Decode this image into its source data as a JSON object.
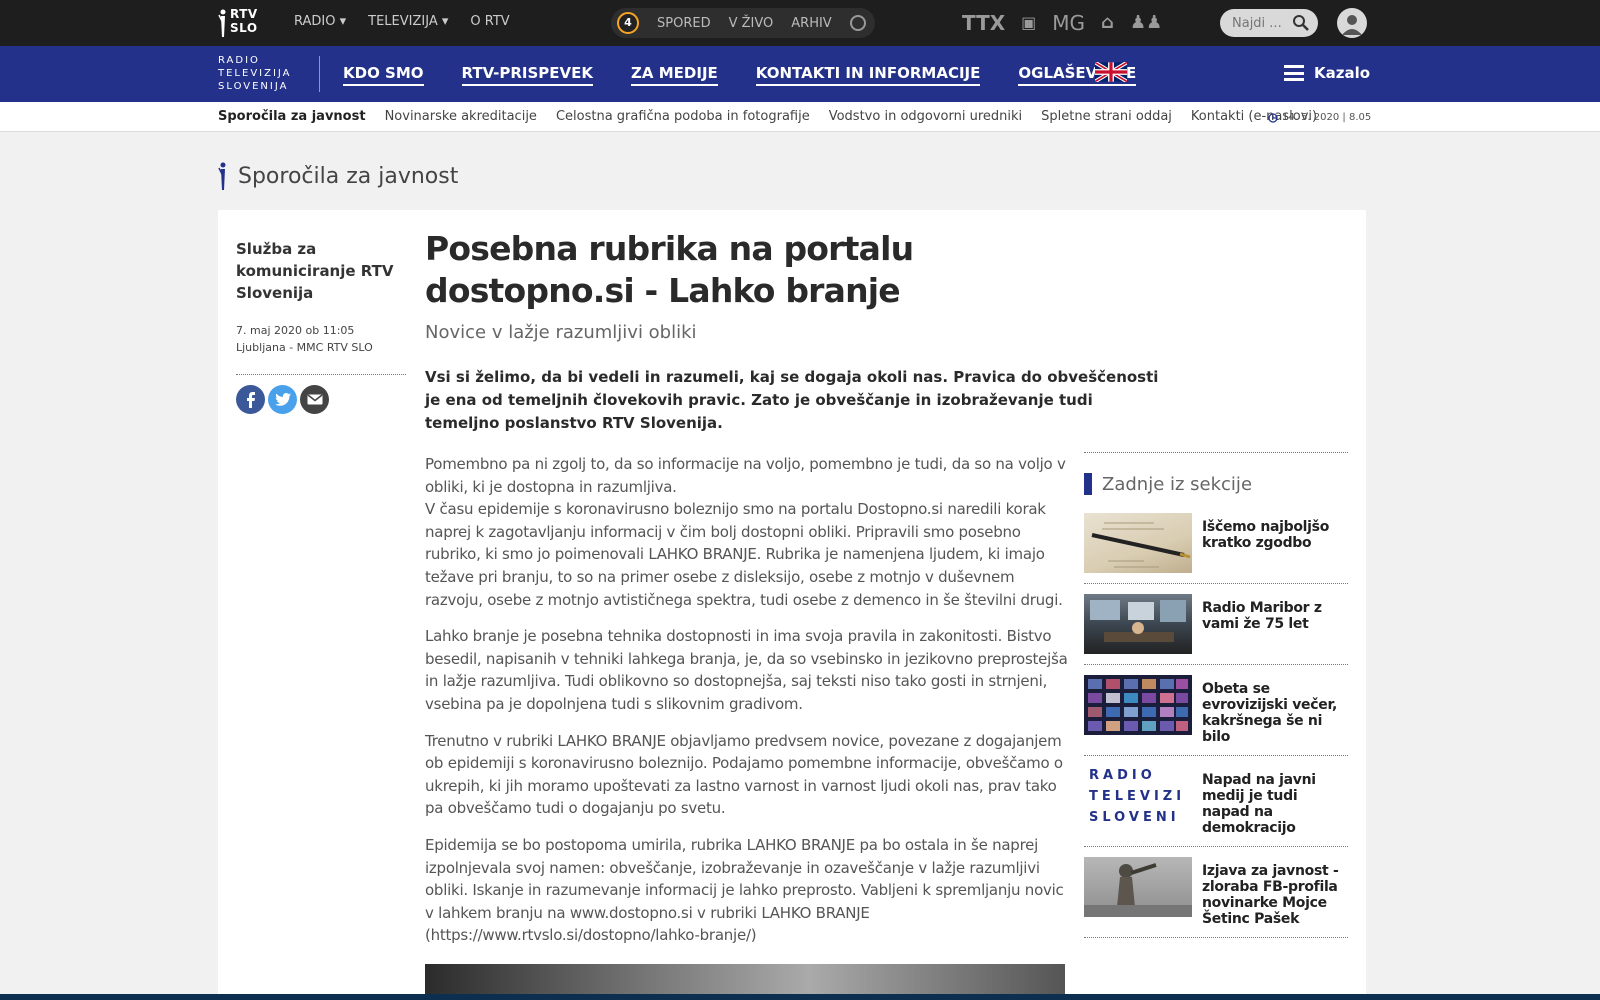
{
  "topbar": {
    "logo_text": [
      "RTV",
      "SLO"
    ],
    "nav": [
      "RADIO",
      "TELEVIZIJA",
      "O RTV"
    ],
    "pill_channel": "4",
    "pill_items": [
      "SPORED",
      "V ŽIVO",
      "ARHIV"
    ],
    "brand_icons": [
      "TTX",
      "Otv",
      "MG",
      "rtv",
      "ljudje"
    ],
    "search_placeholder": "Najdi ...",
    "colors": {
      "bg": "#1e1e1e",
      "channel_ring": "#f4a623"
    }
  },
  "bluebar": {
    "org_lines": [
      "RADIO",
      "TELEVIZIJA",
      "SLOVENIJA"
    ],
    "nav": [
      "KDO SMO",
      "RTV-PRISPEVEK",
      "ZA MEDIJE",
      "KONTAKTI IN INFORMACIJE",
      "OGLAŠEVANJE"
    ],
    "kazalo": "Kazalo",
    "color": "#23318a"
  },
  "subnav": {
    "items": [
      "Sporočila za javnost",
      "Novinarske akreditacije",
      "Celostna grafična podoba in fotografije",
      "Vodstvo in odgovorni uredniki",
      "Spletne strani oddaj",
      "Kontakti (e-naslovi)"
    ],
    "active_index": 0,
    "date": "14. 5. 2020 | 8.05"
  },
  "section": {
    "title": "Sporočila za javnost"
  },
  "article": {
    "author": "Služba za komuniciranje RTV Slovenija",
    "date": "7. maj 2020 ob 11:05",
    "place": "Ljubljana - MMC RTV SLO",
    "share": [
      "facebook",
      "twitter",
      "email"
    ],
    "headline": "Posebna rubrika na portalu dostopno.si - Lahko branje",
    "subtitle": "Novice v lažje razumljivi obliki",
    "lead": "Vsi si želimo, da bi vedeli in razumeli, kaj se dogaja okoli nas. Pravica do obveščenosti je ena od temeljnih človekovih pravic. Zato je obveščanje in izobraževanje tudi temeljno poslanstvo RTV Slovenija.",
    "p1a": "Pomembno pa ni zgolj to, da so informacije na voljo, pomembno je tudi, da so na voljo v obliki, ki je dostopna in razumljiva.",
    "p1b": "V času epidemije s koronavirusno boleznijo smo na portalu Dostopno.si naredili korak naprej k zagotavljanju informacij v čim bolj dostopni obliki. Pripravili smo posebno rubriko, ki smo jo poimenovali LAHKO BRANJE. Rubrika je namenjena ljudem, ki imajo težave pri branju, to so na primer osebe z disleksijo, osebe z motnjo v duševnem razvoju, osebe z motnjo avtističnega spektra, tudi osebe z demenco in še številni drugi.",
    "p2": "Lahko branje je posebna tehnika dostopnosti in ima svoja pravila in zakonitosti. Bistvo besedil, napisanih v tehniki lahkega branja, je, da so vsebinsko in jezikovno preprostejša in lažje razumljiva. Tudi oblikovno so dostopnejša, saj teksti niso tako gosti in strnjeni, vsebina pa je dopolnjena tudi s slikovnim gradivom.",
    "p3": "Trenutno v rubriki LAHKO BRANJE objavljamo predvsem novice, povezane z dogajanjem ob epidemiji s koronavirusno boleznijo. Podajamo pomembne informacije, obveščamo o ukrepih, ki jih moramo upoštevati za lastno varnost in varnost ljudi okoli nas, prav tako pa obveščamo tudi o dogajanju po svetu.",
    "p4": "Epidemija se bo postopoma umirila, rubrika LAHKO BRANJE pa bo ostala in še naprej izpolnjevala svoj namen: obveščanje, izobraževanje in ozaveščanje v lažje razumljivi obliki. Iskanje in razumevanje informacij je lahko preprosto. Vabljeni k spremljanju novic v lahkem branju na www.dostopno.si v rubriki LAHKO BRANJE (https://www.rtvslo.si/dostopno/lahko-branje/)"
  },
  "sidebar": {
    "title": "Zadnje iz sekcije",
    "items": [
      {
        "title": "Iščemo najboljšo kratko zgodbo",
        "thumb": "pen-paper"
      },
      {
        "title": "Radio Maribor z vami že 75 let",
        "thumb": "radio-studio"
      },
      {
        "title": "Obeta se evrovizijski večer, kakršnega še ni bilo",
        "thumb": "video-grid"
      },
      {
        "title": "Napad na javni medij je tudi napad na demokracijo",
        "thumb": "logo-text",
        "thumb_text": "RADIO TELEVIZI SLOVENI"
      },
      {
        "title": "Izjava za javnost - zloraba FB-profila novinarke Mojce Šetinc Pašek",
        "thumb": "statue"
      }
    ]
  }
}
